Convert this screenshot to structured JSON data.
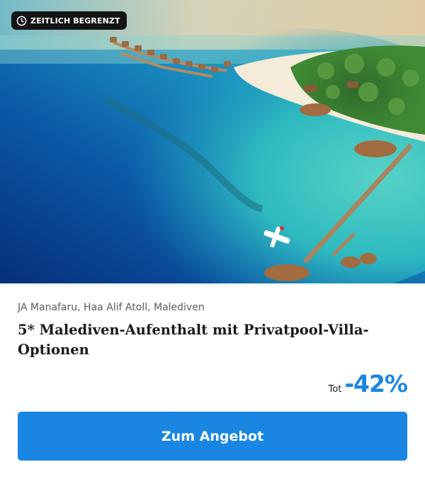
{
  "badge": {
    "icon": "clock-icon",
    "label": "ZEITLICH BEGRENZT"
  },
  "hero": {
    "description_icon": "resort-photo"
  },
  "offer": {
    "location": "JA Manafaru, Haa Alif Atoll, Malediven",
    "title": "5* Malediven-Aufenthalt mit Privatpool-Villa-Optionen",
    "price_prefix": "Tot",
    "discount": "-42%"
  },
  "cta": {
    "label": "Zum Angebot"
  },
  "colors": {
    "accent": "#1a86e2",
    "discount": "#1a86e2",
    "badge_bg": "#141414"
  }
}
